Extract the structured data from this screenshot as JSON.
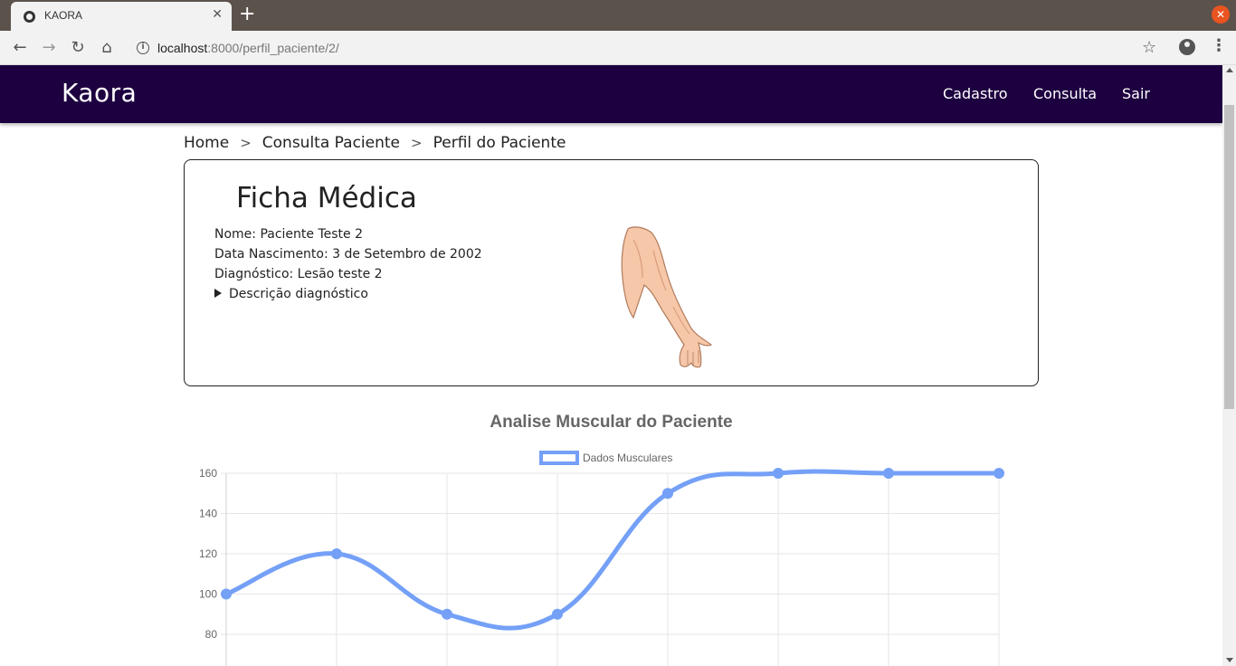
{
  "browser": {
    "tab_title": "KAORA",
    "url_host": "localhost",
    "url_path": ":8000/perfil_paciente/2/"
  },
  "navbar": {
    "brand": "Kaora",
    "links": [
      "Cadastro",
      "Consulta",
      "Sair"
    ]
  },
  "breadcrumb": {
    "items": [
      "Home",
      "Consulta Paciente",
      "Perfil do Paciente"
    ],
    "separator": ">"
  },
  "ficha": {
    "title": "Ficha Médica",
    "nome": "Nome: Paciente Teste 2",
    "nascimento": "Data Nascimento: 3 de Setembro de 2002",
    "diagnostico": "Diagnóstico: Lesão teste 2",
    "descricao_toggle": "Descrição diagnóstico"
  },
  "colors": {
    "navbar": "#1d0040",
    "series": "#74a0f7"
  },
  "chart_data": {
    "type": "line",
    "title": "Analise Muscular do Paciente",
    "series": [
      {
        "name": "Dados Musculares",
        "values": [
          100,
          120,
          90,
          90,
          150,
          160,
          160,
          160
        ]
      }
    ],
    "ylim": [
      80,
      160
    ],
    "y_ticks": [
      160,
      140,
      120,
      100,
      80
    ],
    "grid": true,
    "legend_position": "top"
  }
}
